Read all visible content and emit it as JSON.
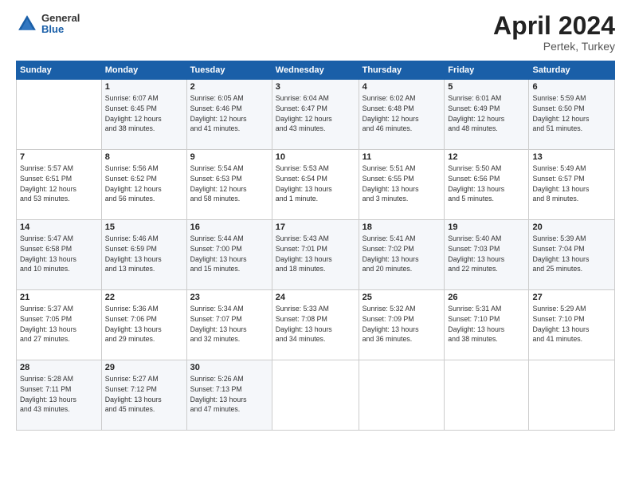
{
  "header": {
    "logo": {
      "general": "General",
      "blue": "Blue"
    },
    "title": "April 2024",
    "subtitle": "Pertek, Turkey"
  },
  "calendar": {
    "days_of_week": [
      "Sunday",
      "Monday",
      "Tuesday",
      "Wednesday",
      "Thursday",
      "Friday",
      "Saturday"
    ],
    "weeks": [
      [
        {
          "day": "",
          "details": []
        },
        {
          "day": "1",
          "details": [
            "Sunrise: 6:07 AM",
            "Sunset: 6:45 PM",
            "Daylight: 12 hours",
            "and 38 minutes."
          ]
        },
        {
          "day": "2",
          "details": [
            "Sunrise: 6:05 AM",
            "Sunset: 6:46 PM",
            "Daylight: 12 hours",
            "and 41 minutes."
          ]
        },
        {
          "day": "3",
          "details": [
            "Sunrise: 6:04 AM",
            "Sunset: 6:47 PM",
            "Daylight: 12 hours",
            "and 43 minutes."
          ]
        },
        {
          "day": "4",
          "details": [
            "Sunrise: 6:02 AM",
            "Sunset: 6:48 PM",
            "Daylight: 12 hours",
            "and 46 minutes."
          ]
        },
        {
          "day": "5",
          "details": [
            "Sunrise: 6:01 AM",
            "Sunset: 6:49 PM",
            "Daylight: 12 hours",
            "and 48 minutes."
          ]
        },
        {
          "day": "6",
          "details": [
            "Sunrise: 5:59 AM",
            "Sunset: 6:50 PM",
            "Daylight: 12 hours",
            "and 51 minutes."
          ]
        }
      ],
      [
        {
          "day": "7",
          "details": [
            "Sunrise: 5:57 AM",
            "Sunset: 6:51 PM",
            "Daylight: 12 hours",
            "and 53 minutes."
          ]
        },
        {
          "day": "8",
          "details": [
            "Sunrise: 5:56 AM",
            "Sunset: 6:52 PM",
            "Daylight: 12 hours",
            "and 56 minutes."
          ]
        },
        {
          "day": "9",
          "details": [
            "Sunrise: 5:54 AM",
            "Sunset: 6:53 PM",
            "Daylight: 12 hours",
            "and 58 minutes."
          ]
        },
        {
          "day": "10",
          "details": [
            "Sunrise: 5:53 AM",
            "Sunset: 6:54 PM",
            "Daylight: 13 hours",
            "and 1 minute."
          ]
        },
        {
          "day": "11",
          "details": [
            "Sunrise: 5:51 AM",
            "Sunset: 6:55 PM",
            "Daylight: 13 hours",
            "and 3 minutes."
          ]
        },
        {
          "day": "12",
          "details": [
            "Sunrise: 5:50 AM",
            "Sunset: 6:56 PM",
            "Daylight: 13 hours",
            "and 5 minutes."
          ]
        },
        {
          "day": "13",
          "details": [
            "Sunrise: 5:49 AM",
            "Sunset: 6:57 PM",
            "Daylight: 13 hours",
            "and 8 minutes."
          ]
        }
      ],
      [
        {
          "day": "14",
          "details": [
            "Sunrise: 5:47 AM",
            "Sunset: 6:58 PM",
            "Daylight: 13 hours",
            "and 10 minutes."
          ]
        },
        {
          "day": "15",
          "details": [
            "Sunrise: 5:46 AM",
            "Sunset: 6:59 PM",
            "Daylight: 13 hours",
            "and 13 minutes."
          ]
        },
        {
          "day": "16",
          "details": [
            "Sunrise: 5:44 AM",
            "Sunset: 7:00 PM",
            "Daylight: 13 hours",
            "and 15 minutes."
          ]
        },
        {
          "day": "17",
          "details": [
            "Sunrise: 5:43 AM",
            "Sunset: 7:01 PM",
            "Daylight: 13 hours",
            "and 18 minutes."
          ]
        },
        {
          "day": "18",
          "details": [
            "Sunrise: 5:41 AM",
            "Sunset: 7:02 PM",
            "Daylight: 13 hours",
            "and 20 minutes."
          ]
        },
        {
          "day": "19",
          "details": [
            "Sunrise: 5:40 AM",
            "Sunset: 7:03 PM",
            "Daylight: 13 hours",
            "and 22 minutes."
          ]
        },
        {
          "day": "20",
          "details": [
            "Sunrise: 5:39 AM",
            "Sunset: 7:04 PM",
            "Daylight: 13 hours",
            "and 25 minutes."
          ]
        }
      ],
      [
        {
          "day": "21",
          "details": [
            "Sunrise: 5:37 AM",
            "Sunset: 7:05 PM",
            "Daylight: 13 hours",
            "and 27 minutes."
          ]
        },
        {
          "day": "22",
          "details": [
            "Sunrise: 5:36 AM",
            "Sunset: 7:06 PM",
            "Daylight: 13 hours",
            "and 29 minutes."
          ]
        },
        {
          "day": "23",
          "details": [
            "Sunrise: 5:34 AM",
            "Sunset: 7:07 PM",
            "Daylight: 13 hours",
            "and 32 minutes."
          ]
        },
        {
          "day": "24",
          "details": [
            "Sunrise: 5:33 AM",
            "Sunset: 7:08 PM",
            "Daylight: 13 hours",
            "and 34 minutes."
          ]
        },
        {
          "day": "25",
          "details": [
            "Sunrise: 5:32 AM",
            "Sunset: 7:09 PM",
            "Daylight: 13 hours",
            "and 36 minutes."
          ]
        },
        {
          "day": "26",
          "details": [
            "Sunrise: 5:31 AM",
            "Sunset: 7:10 PM",
            "Daylight: 13 hours",
            "and 38 minutes."
          ]
        },
        {
          "day": "27",
          "details": [
            "Sunrise: 5:29 AM",
            "Sunset: 7:10 PM",
            "Daylight: 13 hours",
            "and 41 minutes."
          ]
        }
      ],
      [
        {
          "day": "28",
          "details": [
            "Sunrise: 5:28 AM",
            "Sunset: 7:11 PM",
            "Daylight: 13 hours",
            "and 43 minutes."
          ]
        },
        {
          "day": "29",
          "details": [
            "Sunrise: 5:27 AM",
            "Sunset: 7:12 PM",
            "Daylight: 13 hours",
            "and 45 minutes."
          ]
        },
        {
          "day": "30",
          "details": [
            "Sunrise: 5:26 AM",
            "Sunset: 7:13 PM",
            "Daylight: 13 hours",
            "and 47 minutes."
          ]
        },
        {
          "day": "",
          "details": []
        },
        {
          "day": "",
          "details": []
        },
        {
          "day": "",
          "details": []
        },
        {
          "day": "",
          "details": []
        }
      ]
    ]
  }
}
